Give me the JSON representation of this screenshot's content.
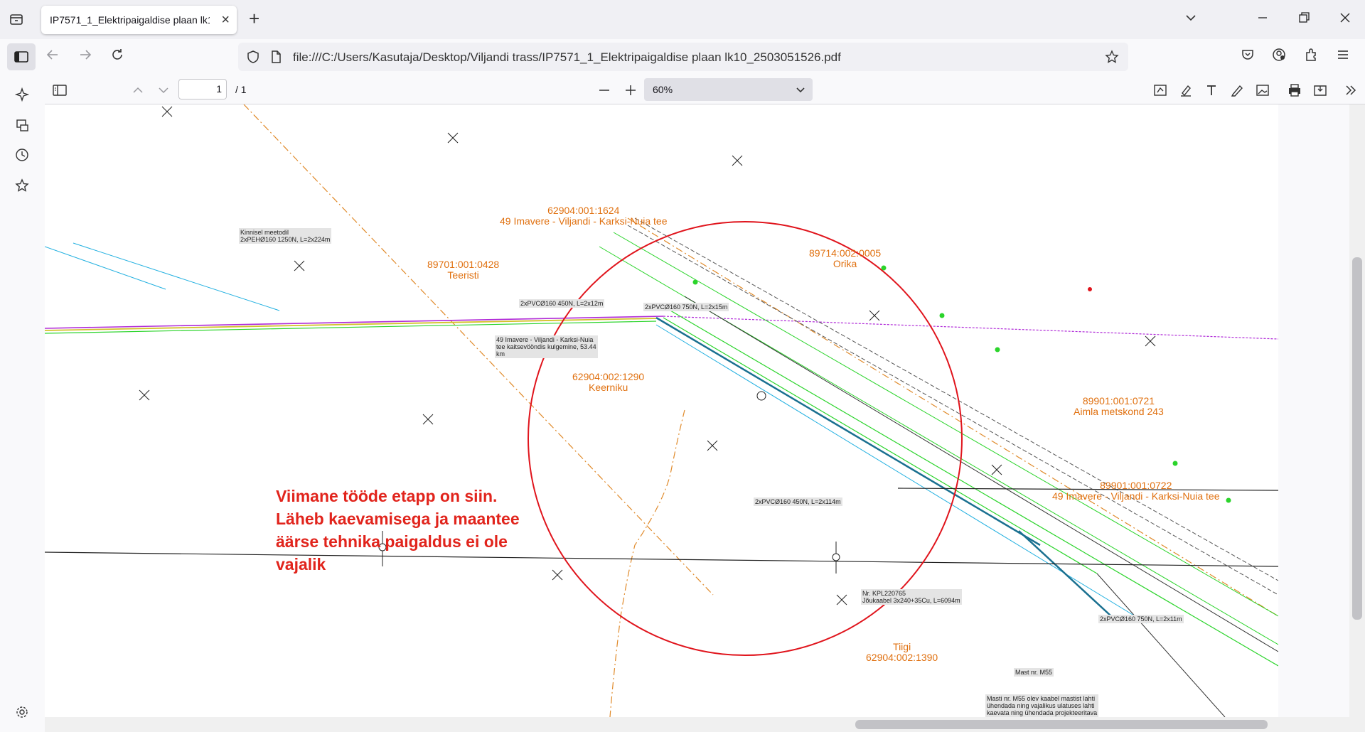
{
  "browser": {
    "tab_title": "IP7571_1_Elektripaigaldise plaan lk10",
    "url": "file:///C:/Users/Kasutaja/Desktop/Viljandi trass/IP7571_1_Elektripaigaldise plaan lk10_2503051526.pdf"
  },
  "pdf_toolbar": {
    "page_number": "1",
    "page_total": "/ 1",
    "zoom_value": "60%"
  },
  "annotation": {
    "line1": "Viimane tööde etapp on siin.",
    "line2": "Läheb kaevamisega ja maantee",
    "line3": "äärse tehnika paigaldus ei ole",
    "line4": "vajalik"
  },
  "parcels": {
    "p1_id": "62904:001:1624",
    "p1_name": "49 Imavere - Viljandi - Karksi-Nuia tee",
    "p2_id": "89701:001:0428",
    "p2_name": "Teeristi",
    "p3_id": "89714:002:0005",
    "p3_name": "Orika",
    "p4_id": "62904:002:1290",
    "p4_name": "Keerniku",
    "p5_id": "89901:001:0721",
    "p5_name": "Aimla metskond 243",
    "p6_id": "89901:001:0722",
    "p6_name": "49 Imavere - Viljandi - Karksi-Nuia tee",
    "p7_name": "Tiigi",
    "p7_id": "62904:002:1390"
  },
  "labels": {
    "kinnisel_1": "Kinnisel meetodil",
    "kinnisel_2": "2xPEHØ160 1250N, L=2x224m",
    "pvc_450": "2xPVCØ160 450N, L=2x12m",
    "pvc_750_15": "2xPVCØ160 750N, L=2x15m",
    "kaitse_1": "49 Imavere - Viljandi - Karksi-Nuia",
    "kaitse_2": "tee kaitsevööndis kulgemine, 53.44",
    "kaitse_3": "km",
    "pvc_114": "2xPVCØ160 450N, L=2x114m",
    "kpl_1": "Nr. KPL220765",
    "kpl_2": "Jõukaabel 3x240+35Cu, L=6094m",
    "pvc_750_11": "2xPVCØ160 750N, L=2x11m",
    "mast": "Mast nr. M55",
    "masti_1": "Masti nr. M55 olev kaabel mastist lahti",
    "masti_2": "ühendada ning vajalikus ulatuses lahti",
    "masti_3": "kaevata ning ühendada projekteeritava"
  },
  "colors": {
    "annotation_red": "#e1241c",
    "parcel_orange": "#e0700f",
    "cable_green": "#2bd42b",
    "circle_red": "#e0141c",
    "boundary_purple": "#b02ad8"
  }
}
